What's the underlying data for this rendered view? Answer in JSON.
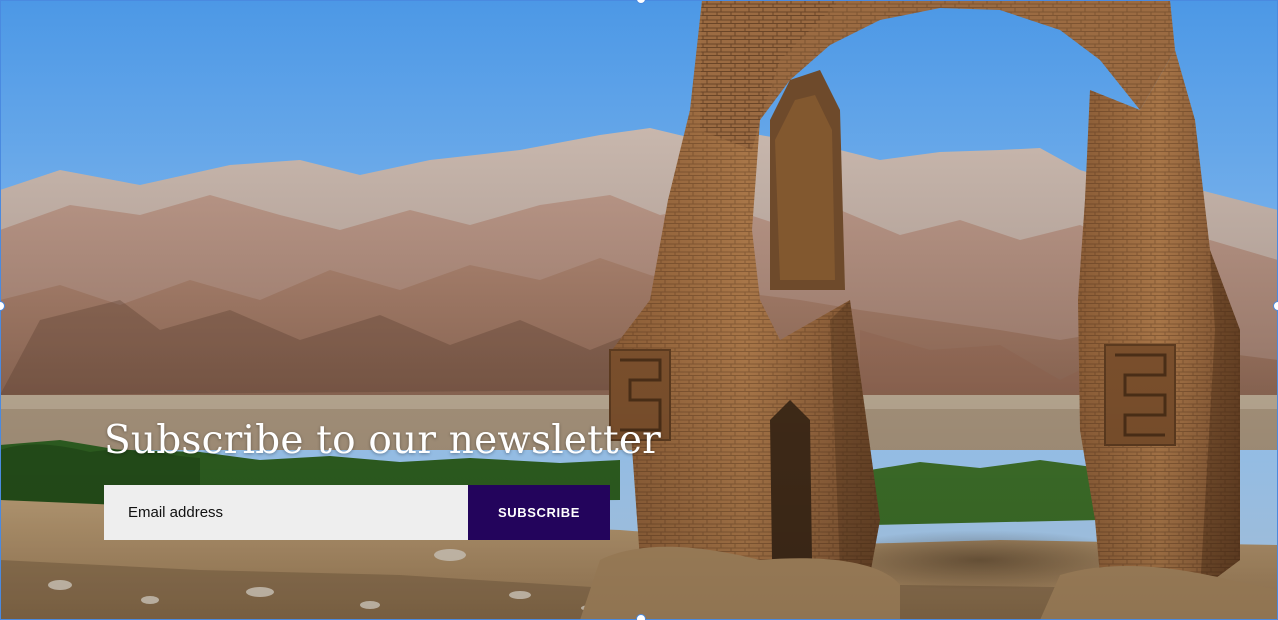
{
  "hero": {
    "image_icon": "ruined-arch-landscape-image",
    "colors": {
      "sky_top": "#4c98e6",
      "sky_bottom": "#b8d6f2",
      "mountain_far": "#b9aaa1",
      "mountain_mid": "#a5897a",
      "mountain_near": "#8e6c5d",
      "vegetation": "#2d5d20",
      "ground": "#a88b63",
      "arch": "#9a6a40",
      "arch_dark": "#6e4a2b"
    }
  },
  "newsletter": {
    "title": "Subscribe to our newsletter",
    "email_placeholder": "Email address",
    "button_label": "SUBSCRIBE",
    "button_color": "#23045c",
    "input_background": "#eeeeee"
  },
  "selection_frame": {
    "color": "#4a8ae0"
  }
}
